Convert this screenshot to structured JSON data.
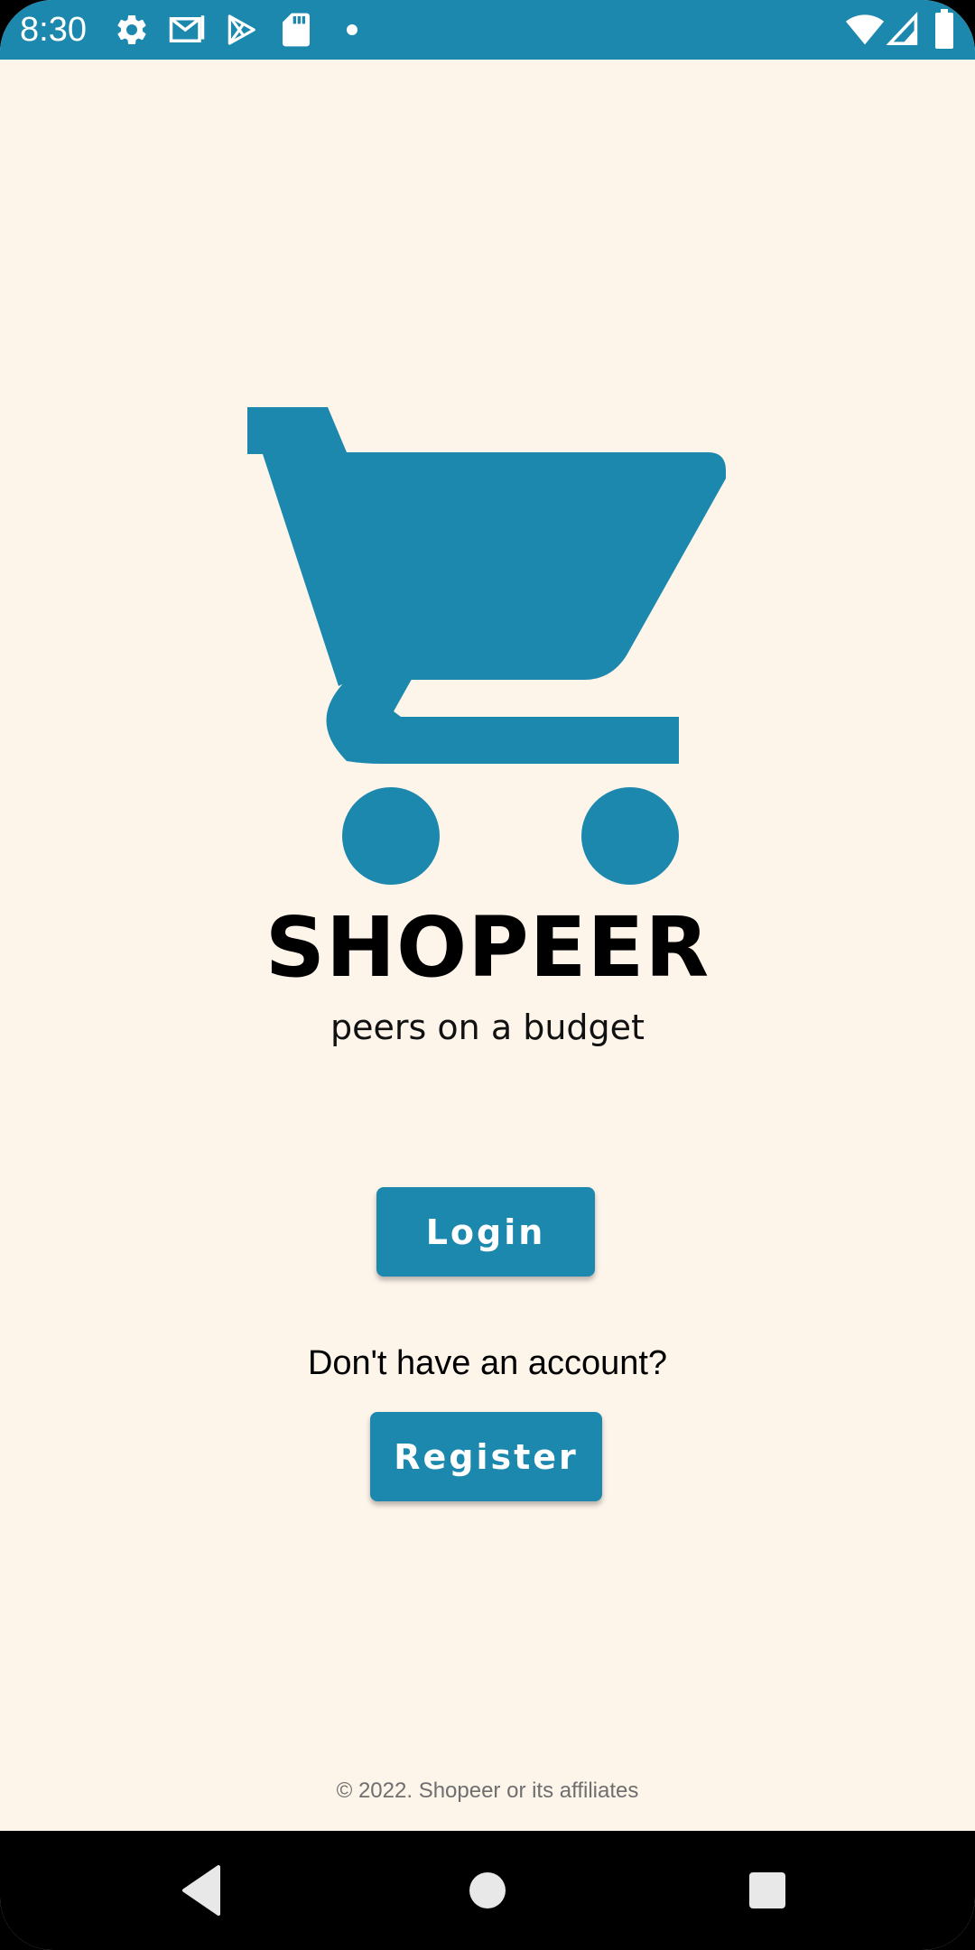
{
  "status_bar": {
    "time": "8:30",
    "icons_left": [
      "gear-icon",
      "gmail-icon",
      "play-store-icon",
      "sd-card-icon",
      "notification-dot-icon"
    ],
    "icons_right": [
      "wifi-icon",
      "cellular-signal-icon",
      "battery-icon"
    ]
  },
  "colors": {
    "accent": "#1C88AE",
    "background": "#FDF4EA",
    "text": "#000000",
    "muted_text": "#6F6F6F"
  },
  "branding": {
    "logo_icon": "shopping-cart-icon",
    "title": "SHOPEER",
    "tagline": "peers on a budget"
  },
  "actions": {
    "login_label": "Login",
    "register_prompt": "Don't have an account?",
    "register_label": "Register"
  },
  "footer": {
    "copyright": "© 2022. Shopeer or its affiliates"
  },
  "nav_bar": {
    "buttons": [
      "back-icon",
      "home-icon",
      "recents-icon"
    ]
  }
}
